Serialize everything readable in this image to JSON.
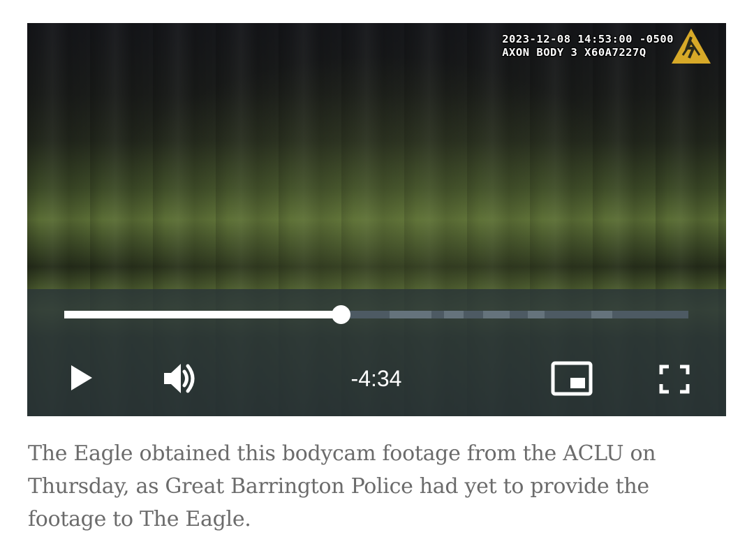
{
  "video": {
    "timestamp": "2023-12-08 14:53:00 -0500",
    "device": "AXON BODY 3 X60A7227Q",
    "logo_icon": "axon-delta-logo-icon",
    "progress": 0.443,
    "time_remaining": "-4:34",
    "controls": {
      "play_icon": "play-icon",
      "volume_icon": "volume-icon",
      "pip_icon": "picture-in-picture-icon",
      "fullscreen_icon": "fullscreen-icon"
    },
    "colors": {
      "logo": "#d7a928",
      "control_bar": "#2a3438",
      "progress_fill": "#ffffff"
    }
  },
  "caption": "The Eagle obtained this bodycam footage from the ACLU on Thursday, as Great Barrington Police had yet to provide the footage to The Eagle."
}
